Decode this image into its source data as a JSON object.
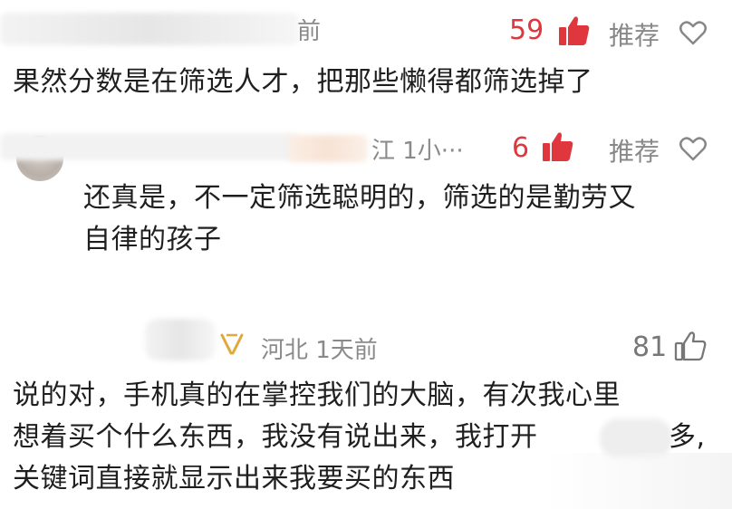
{
  "comments": [
    {
      "meta_suffix": "前",
      "likes": "59",
      "recommend": "推荐",
      "text": "果然分数是在筛选人才，把那些懒得都筛选掉了"
    },
    {
      "meta": "江 1小···",
      "likes": "6",
      "recommend": "推荐",
      "text_line1": "还真是，不一定筛选聪明的，筛选的是勤劳又",
      "text_line2": "自律的孩子"
    },
    {
      "meta": "河北 1天前",
      "likes": "81",
      "text_line1": "说的对，手机真的在掌控我们的大脑，有次我心里",
      "text_line2_a": "想着买个什么东西，我没有说出来，我打开",
      "text_line2_b": "多,",
      "text_line3": "关键词直接就显示出来我要买的东西"
    }
  ],
  "colors": {
    "liked_red": "#e0373f",
    "meta_gray": "#8a8a8a",
    "badge_gold": "#e0a93b"
  },
  "icons": [
    "thumbs-up-filled-icon",
    "heart-outline-icon",
    "thumbs-up-outline-icon",
    "user-badge-icon"
  ]
}
